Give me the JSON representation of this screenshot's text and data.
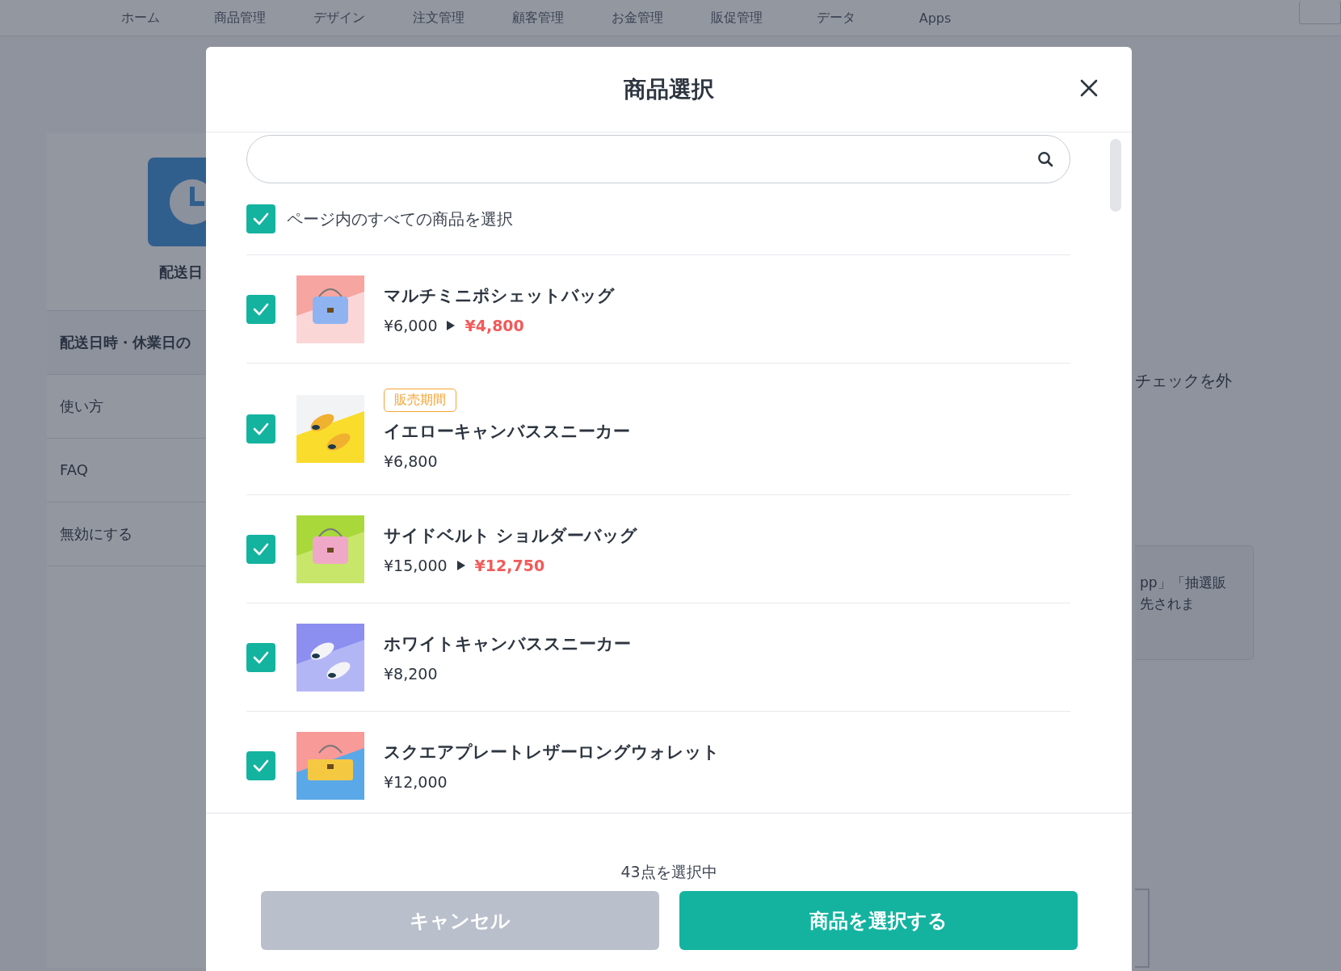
{
  "nav": {
    "items": [
      "ホーム",
      "商品管理",
      "デザイン",
      "注文管理",
      "顧客管理",
      "お金管理",
      "販促管理",
      "データ",
      "Apps"
    ]
  },
  "sidebar": {
    "title": "配送日",
    "items": [
      {
        "label": "配送日時・休業日の",
        "selected": true
      },
      {
        "label": "使い方",
        "selected": false
      },
      {
        "label": "FAQ",
        "selected": false
      },
      {
        "label": "無効にする",
        "selected": false
      }
    ]
  },
  "background_text": {
    "line": "チェックを外",
    "note_lines": [
      "pp」「抽選販",
      "先されま"
    ]
  },
  "modal": {
    "title": "商品選択",
    "select_all": {
      "label": "ページ内のすべての商品を選択",
      "checked": true
    },
    "products": [
      {
        "name": "マルチミニポシェットバッグ",
        "price": "¥6,000",
        "sale_price": "¥4,800",
        "checked": true
      },
      {
        "badge": "販売期間",
        "name": "イエローキャンバススニーカー",
        "price": "¥6,800",
        "checked": true
      },
      {
        "name": "サイドベルト ショルダーバッグ",
        "price": "¥15,000",
        "sale_price": "¥12,750",
        "checked": true
      },
      {
        "name": "ホワイトキャンバススニーカー",
        "price": "¥8,200",
        "checked": true
      },
      {
        "name": "スクエアプレートレザーロングウォレット",
        "price": "¥12,000",
        "checked": true
      }
    ],
    "selection_count": "43点を選択中",
    "cancel_button": "キャンセル",
    "confirm_button": "商品を選択する"
  }
}
